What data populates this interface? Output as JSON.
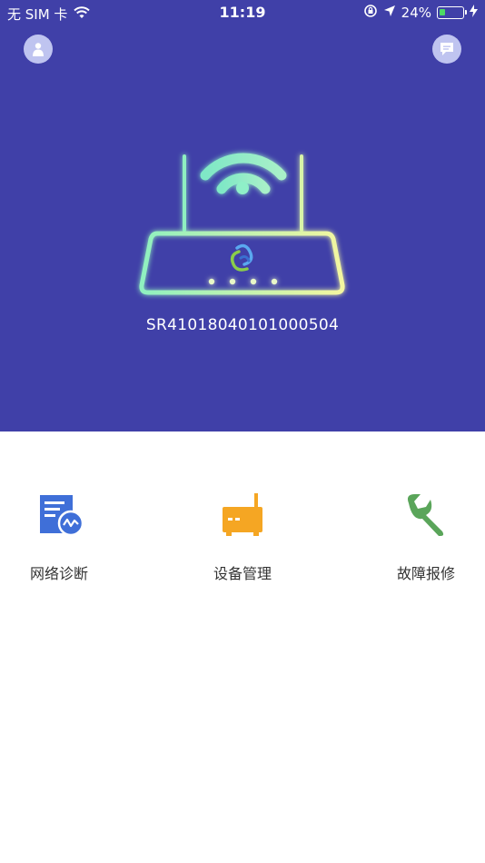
{
  "status_bar": {
    "carrier": "无 SIM 卡",
    "time": "11:19",
    "battery_percent": "24%",
    "battery_level": 0.24
  },
  "header": {
    "profile_icon": "person-icon",
    "message_icon": "chat-icon"
  },
  "device": {
    "serial": "SR41018040101000504"
  },
  "menu": {
    "items": [
      {
        "label": "网络诊断",
        "icon": "network-diagnosis-icon",
        "color": "#3f6fd8"
      },
      {
        "label": "设备管理",
        "icon": "router-device-icon",
        "color": "#f5a623"
      },
      {
        "label": "故障报修",
        "icon": "wrench-icon",
        "color": "#5aa55a"
      }
    ]
  },
  "colors": {
    "hero_background": "#4040a8",
    "battery_fill": "#4cd964"
  }
}
